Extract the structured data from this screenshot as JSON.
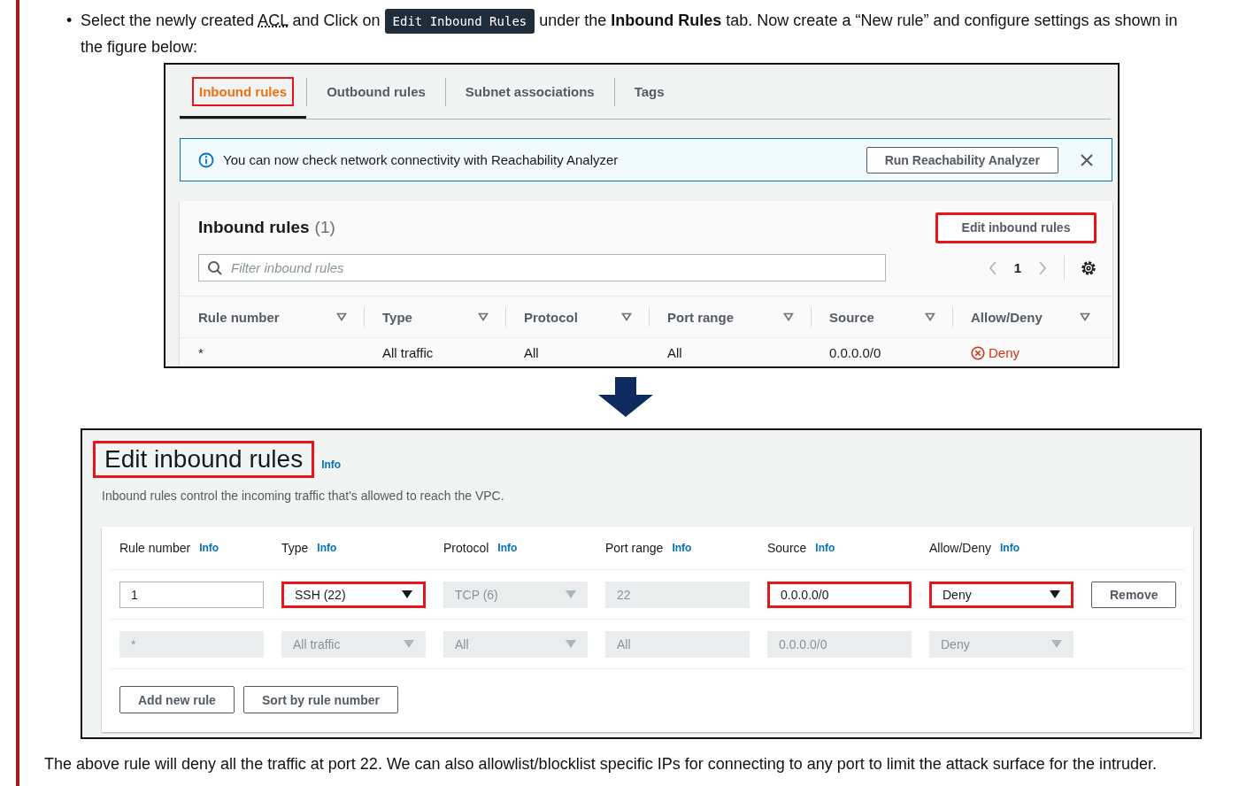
{
  "bullet": "•",
  "intro": [
    {
      "kind": "text",
      "text": "Select the newly created "
    },
    {
      "kind": "abbr",
      "text": "ACL"
    },
    {
      "kind": "text",
      "text": " and Click on "
    },
    {
      "kind": "code",
      "text": "Edit Inbound Rules"
    },
    {
      "kind": "text",
      "text": " under the **Inbound Rules** tab. Now create a “New rule” and configure settings as shown in the figure below:"
    }
  ],
  "details_tabs": [
    {
      "label": "Inbound rules",
      "selected": true,
      "annotated": true
    },
    {
      "label": "Outbound rules",
      "selected": false,
      "annotated": false
    },
    {
      "label": "Subnet associations",
      "selected": false,
      "annotated": false
    },
    {
      "label": "Tags",
      "selected": false,
      "annotated": false
    }
  ],
  "notice": {
    "text": "You can now check network connectivity with Reachability Analyzer",
    "button": "Run Reachability Analyzer"
  },
  "rules_panel": {
    "title": "Inbound rules",
    "count": "(1)",
    "edit_button": {
      "label": "Edit inbound rules",
      "annotated": true
    },
    "filter_placeholder": "Filter inbound rules",
    "page": "1",
    "columns": [
      "Rule number",
      "Type",
      "Protocol",
      "Port range",
      "Source",
      "Allow/Deny"
    ],
    "rows": [
      {
        "cells": [
          "*",
          "All traffic",
          "All",
          "All",
          "0.0.0.0/0"
        ],
        "action": {
          "label": "Deny",
          "kind": "deny"
        }
      }
    ]
  },
  "edit_form": {
    "title": "Edit inbound rules",
    "title_annotated": true,
    "title_info": "Info",
    "description": "Inbound rules control the incoming traffic that's allowed to reach the VPC.",
    "columns": [
      {
        "label": "Rule number",
        "info": "Info"
      },
      {
        "label": "Type",
        "info": "Info"
      },
      {
        "label": "Protocol",
        "info": "Info"
      },
      {
        "label": "Port range",
        "info": "Info"
      },
      {
        "label": "Source",
        "info": "Info"
      },
      {
        "label": "Allow/Deny",
        "info": "Info"
      }
    ],
    "rows": [
      {
        "fields": [
          {
            "kind": "input",
            "value": "1",
            "disabled": false,
            "annotated": false
          },
          {
            "kind": "select",
            "value": "SSH (22)",
            "disabled": false,
            "annotated": true
          },
          {
            "kind": "select",
            "value": "TCP (6)",
            "disabled": true,
            "annotated": false
          },
          {
            "kind": "input",
            "value": "22",
            "disabled": true,
            "annotated": false
          },
          {
            "kind": "input",
            "value": "0.0.0.0/0",
            "disabled": false,
            "annotated": true
          },
          {
            "kind": "select",
            "value": "Deny",
            "disabled": false,
            "annotated": true
          }
        ],
        "remove": "Remove"
      },
      {
        "fields": [
          {
            "kind": "input",
            "value": "*",
            "disabled": true,
            "annotated": false
          },
          {
            "kind": "select",
            "value": "All traffic",
            "disabled": true,
            "annotated": false
          },
          {
            "kind": "select",
            "value": "All",
            "disabled": true,
            "annotated": false
          },
          {
            "kind": "input",
            "value": "All",
            "disabled": true,
            "annotated": false
          },
          {
            "kind": "input",
            "value": "0.0.0.0/0",
            "disabled": true,
            "annotated": false
          },
          {
            "kind": "select",
            "value": "Deny",
            "disabled": true,
            "annotated": false
          }
        ]
      }
    ],
    "buttons": [
      "Add new rule",
      "Sort by rule number"
    ]
  },
  "conclusion": "The above rule will deny all the traffic at port 22. We can also allowlist/blocklist specific IPs for connecting to any port to limit the attack surface for the intruder."
}
